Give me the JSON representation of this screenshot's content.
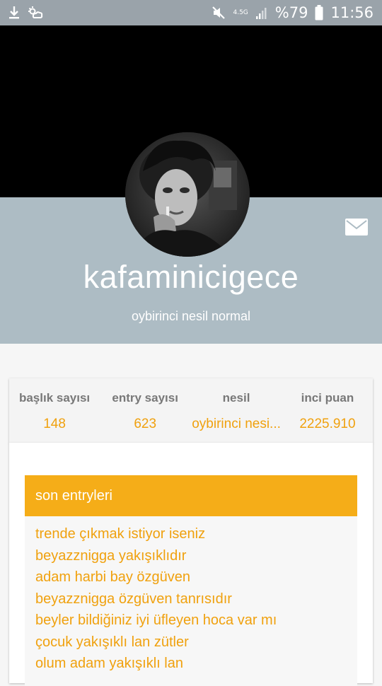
{
  "status_bar": {
    "network": "4.5G",
    "battery_percent": "%79",
    "time": "11:56"
  },
  "profile": {
    "username": "kafaminicigece",
    "rank": "oybirinci nesil normal"
  },
  "stats": [
    {
      "label": "başlık sayısı",
      "value": "148"
    },
    {
      "label": "entry sayısı",
      "value": "623"
    },
    {
      "label": "nesil",
      "value": "oybirinci nesi..."
    },
    {
      "label": "inci puan",
      "value": "2225.910"
    }
  ],
  "recent_entries": {
    "header": "son entryleri",
    "items": [
      "trende çıkmak istiyor iseniz",
      "beyazznigga yakışıklıdır",
      "adam harbi bay özgüven",
      "beyazznigga özgüven tanrısıdır",
      "beyler bildiğiniz iyi üfleyen hoca var mı",
      "çocuk yakışıklı lan zütler",
      "olum adam yakışıklı lan"
    ]
  },
  "colors": {
    "status_bar": "#9aa3aa",
    "profile_band": "#adbcc4",
    "accent": "#f5ad18",
    "accent_text": "#f0a10e"
  }
}
